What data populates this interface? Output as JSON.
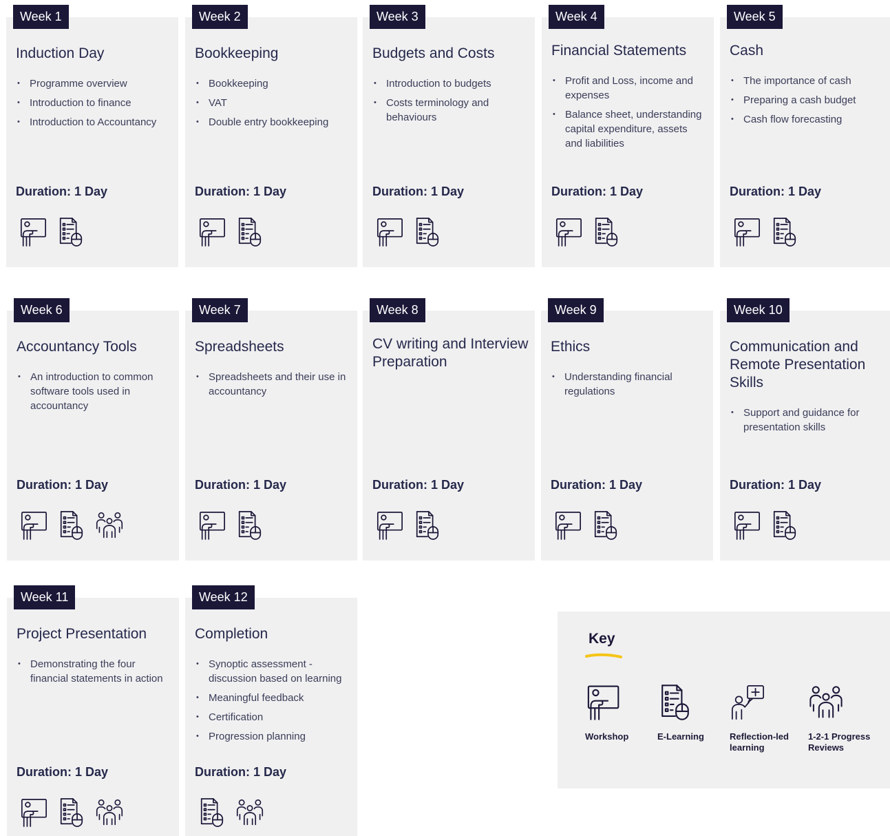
{
  "weeks": [
    {
      "tab": "Week 1",
      "title": "Induction Day",
      "bullets": [
        "Programme overview",
        "Introduction to finance",
        "Introduction to Accountancy"
      ],
      "duration": "Duration: 1 Day",
      "icons": [
        "workshop-icon",
        "e-learning-icon"
      ]
    },
    {
      "tab": "Week 2",
      "title": "Bookkeeping",
      "bullets": [
        "Bookkeeping",
        "VAT",
        "Double entry bookkeeping"
      ],
      "duration": "Duration: 1 Day",
      "icons": [
        "workshop-icon",
        "e-learning-icon"
      ]
    },
    {
      "tab": "Week 3",
      "title": "Budgets and Costs",
      "bullets": [
        "Introduction to budgets",
        "Costs terminology and behaviours"
      ],
      "duration": "Duration: 1 Day",
      "icons": [
        "workshop-icon",
        "e-learning-icon"
      ]
    },
    {
      "tab": "Week 4",
      "title": "Financial Statements",
      "bullets": [
        "Profit and Loss, income and expenses",
        "Balance sheet, understanding capital expenditure, assets and liabilities"
      ],
      "duration": "Duration: 1 Day",
      "icons": [
        "workshop-icon",
        "e-learning-icon"
      ]
    },
    {
      "tab": "Week 5",
      "title": "Cash",
      "bullets": [
        "The importance of cash",
        "Preparing a cash budget",
        "Cash flow forecasting"
      ],
      "duration": "Duration: 1 Day",
      "icons": [
        "workshop-icon",
        "e-learning-icon"
      ]
    },
    {
      "tab": "Week 6",
      "title": "Accountancy Tools",
      "bullets": [
        "An introduction to common software tools used in accountancy"
      ],
      "duration": "Duration: 1 Day",
      "icons": [
        "workshop-icon",
        "e-learning-icon",
        "progress-reviews-icon"
      ]
    },
    {
      "tab": "Week 7",
      "title": "Spreadsheets",
      "bullets": [
        "Spreadsheets and their use in accountancy"
      ],
      "duration": "Duration: 1 Day",
      "icons": [
        "workshop-icon",
        "e-learning-icon"
      ]
    },
    {
      "tab": "Week 8",
      "title": "CV writing and Interview Preparation",
      "bullets": [],
      "duration": "Duration: 1 Day",
      "icons": [
        "workshop-icon",
        "e-learning-icon"
      ]
    },
    {
      "tab": "Week 9",
      "title": "Ethics",
      "bullets": [
        "Understanding financial regulations"
      ],
      "duration": "Duration: 1 Day",
      "icons": [
        "workshop-icon",
        "e-learning-icon"
      ]
    },
    {
      "tab": "Week 10",
      "title": "Communication and Remote Presentation Skills",
      "bullets": [
        "Support and guidance for presentation skills"
      ],
      "duration": "Duration: 1 Day",
      "icons": [
        "workshop-icon",
        "e-learning-icon"
      ]
    },
    {
      "tab": "Week 11",
      "title": "Project Presentation",
      "bullets": [
        "Demonstrating the four financial statements in action"
      ],
      "duration": "Duration: 1 Day",
      "icons": [
        "workshop-icon",
        "e-learning-icon",
        "progress-reviews-icon"
      ]
    },
    {
      "tab": "Week 12",
      "title": "Completion",
      "bullets": [
        "Synoptic assessment - discussion based on learning",
        "Meaningful feedback",
        "Certification",
        "Progression planning"
      ],
      "duration": "Duration: 1 Day",
      "icons": [
        "e-learning-icon",
        "progress-reviews-icon"
      ]
    }
  ],
  "key": {
    "title": "Key",
    "accent": "#f5c518",
    "items": [
      {
        "label": "Workshop",
        "icon": "workshop-icon"
      },
      {
        "label": "E-Learning",
        "icon": "e-learning-icon"
      },
      {
        "label": "Reflection-led learning",
        "icon": "reflection-icon"
      },
      {
        "label": "1-2-1 Progress Reviews",
        "icon": "progress-reviews-icon"
      }
    ]
  },
  "colors": {
    "tab_bg": "#1a1737",
    "card_bg": "#f0f0f1",
    "text": "#25284a"
  }
}
